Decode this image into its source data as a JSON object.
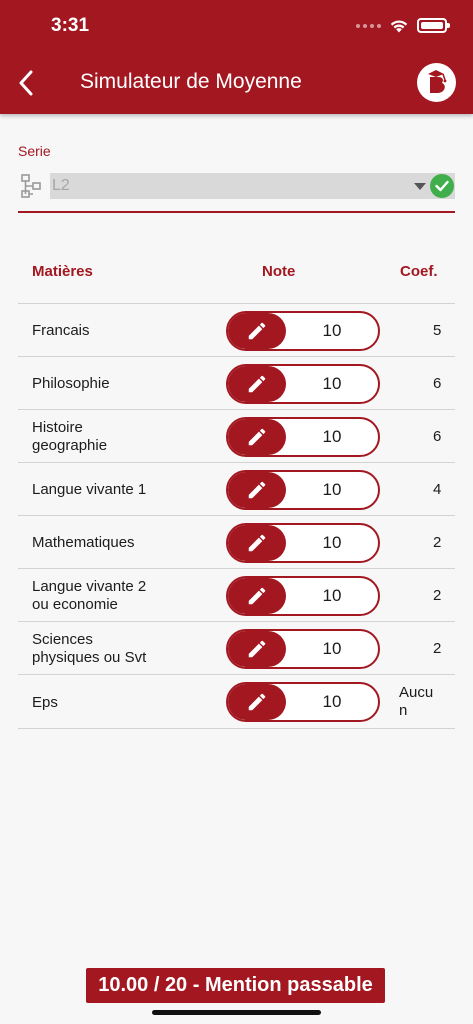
{
  "status_bar": {
    "time": "3:31"
  },
  "header": {
    "title": "Simulateur de Moyenne",
    "back_icon": "chevron-left-icon",
    "logo_icon": "app-logo-b"
  },
  "serie": {
    "label": "Serie",
    "value": "L2",
    "icon": "hierarchy-icon",
    "status_icon": "check-circle-icon",
    "status_color": "#3fae4b"
  },
  "table": {
    "headers": {
      "matiere": "Matières",
      "note": "Note",
      "coef": "Coef."
    },
    "rows": [
      {
        "name": "Francais",
        "note": "10",
        "coef": "5"
      },
      {
        "name": "Philosophie",
        "note": "10",
        "coef": "6"
      },
      {
        "name": "Histoire geographie",
        "note": "10",
        "coef": "6"
      },
      {
        "name": "Langue vivante 1",
        "note": "10",
        "coef": "4"
      },
      {
        "name": "Mathematiques",
        "note": "10",
        "coef": "2"
      },
      {
        "name": "Langue vivante 2 ou economie",
        "note": "10",
        "coef": "2"
      },
      {
        "name": "Sciences physiques ou Svt",
        "note": "10",
        "coef": "2"
      },
      {
        "name": "Eps",
        "note": "10",
        "coef": "Aucun"
      }
    ]
  },
  "result": {
    "text": "10.00 / 20 - Mention passable"
  },
  "colors": {
    "accent": "#a31721",
    "background": "#f7f7f7"
  }
}
